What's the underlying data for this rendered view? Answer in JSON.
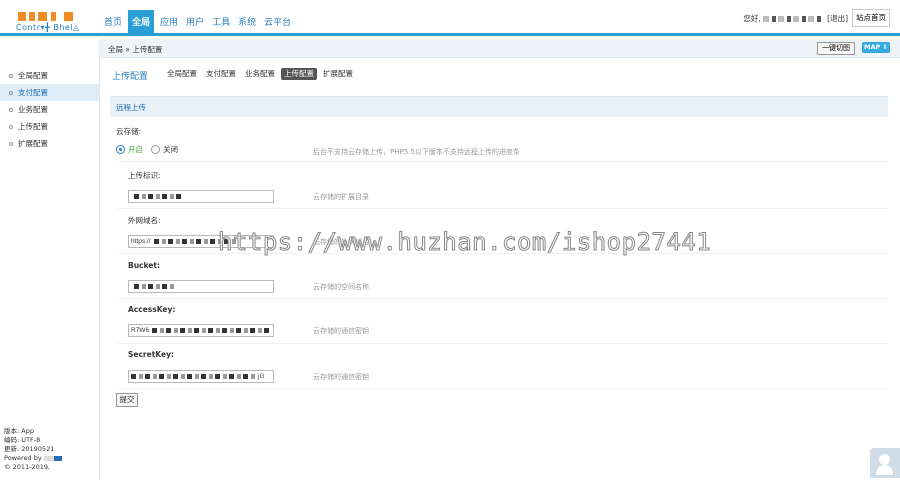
{
  "logo": {
    "subtext": "Contr▾╋ Bhel◬"
  },
  "nav": {
    "items": [
      "首页",
      "全局",
      "应用",
      "用户",
      "工具",
      "系统",
      "云平台"
    ],
    "active": "全局"
  },
  "user": {
    "greeting": "您好,",
    "logout": "[退出]",
    "site_button": "站点首页"
  },
  "breadcrumb": "全局 » 上传配置",
  "quick_menu_button": "一键切图",
  "map_button": "MAP ⇓",
  "sidebar": {
    "items": [
      "全局配置",
      "支付配置",
      "业务配置",
      "上传配置",
      "扩展配置"
    ],
    "active": "支付配置",
    "info": {
      "version": "版本: App",
      "encoding": "编码: UTF-8",
      "updated": "更新: 20190521",
      "powered": "Powered by",
      "copyright": "© 2011-2019,"
    }
  },
  "page": {
    "title": "上传配置",
    "tabs": [
      "全局配置",
      "支付配置",
      "业务配置",
      "上传配置",
      "扩展配置"
    ],
    "active_tab": "上传配置",
    "section": "远程上传"
  },
  "form": {
    "cloud_storage": {
      "label": "云存储:",
      "option_on": "开启",
      "option_off": "关闭",
      "selected": "开启",
      "hint": "后台不支持云存储上传，PHP5.5以下版本不支持远程上传的进度条"
    },
    "upload_id": {
      "label": "上传标识:",
      "value": "",
      "hint": "云存储的扩展目录"
    },
    "external_domain": {
      "label": "外网域名:",
      "value": "https://",
      "hint": "云存储的外网域名"
    },
    "bucket": {
      "label": "Bucket:",
      "value": "",
      "hint": "云存储的空间名称"
    },
    "access_key": {
      "label": "AccessKey:",
      "value": "R7W6",
      "hint": "云存储的通信密钥"
    },
    "secret_key": {
      "label": "SecretKey:",
      "value": "jG",
      "hint": "云存储的通信密钥"
    },
    "submit": "提交"
  },
  "watermark": "https://www.huzhan.com/ishop27441"
}
